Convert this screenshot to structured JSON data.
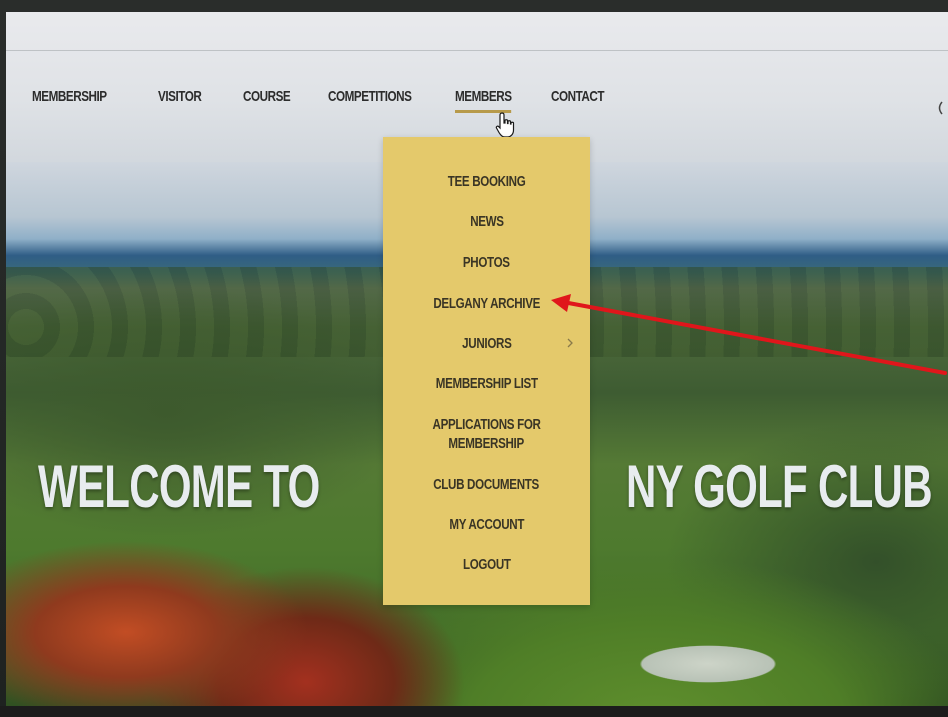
{
  "nav": {
    "items": [
      {
        "label": "MEMBERSHIP",
        "name": "nav-membership"
      },
      {
        "label": "VISITOR",
        "name": "nav-visitor"
      },
      {
        "label": "COURSE",
        "name": "nav-course"
      },
      {
        "label": "COMPETITIONS",
        "name": "nav-competitions"
      },
      {
        "label": "MEMBERS",
        "name": "nav-members"
      },
      {
        "label": "CONTACT",
        "name": "nav-contact"
      }
    ],
    "active": "MEMBERS"
  },
  "members_menu": {
    "items": [
      {
        "label": "TEE BOOKING"
      },
      {
        "label": "NEWS"
      },
      {
        "label": "PHOTOS"
      },
      {
        "label": "DELGANY ARCHIVE"
      },
      {
        "label": "JUNIORS",
        "has_submenu": true
      },
      {
        "label": "MEMBERSHIP LIST"
      },
      {
        "label": "APPLICATIONS FOR",
        "label2": "MEMBERSHIP"
      },
      {
        "label": "CLUB DOCUMENTS"
      },
      {
        "label": "MY ACCOUNT"
      },
      {
        "label": "LOGOUT"
      }
    ]
  },
  "hero": {
    "title_left": "WELCOME TO",
    "title_right": "NY GOLF CLUB"
  },
  "colors": {
    "menu_bg": "#e4c96b",
    "active_underline": "#b79a4a",
    "annotation_arrow": "#e0161b",
    "nav_text": "#2c2c2c"
  },
  "icons": {
    "cursor": "hand-pointer-icon",
    "submenu": "chevron-right-icon",
    "annotation": "arrow-annotation"
  }
}
